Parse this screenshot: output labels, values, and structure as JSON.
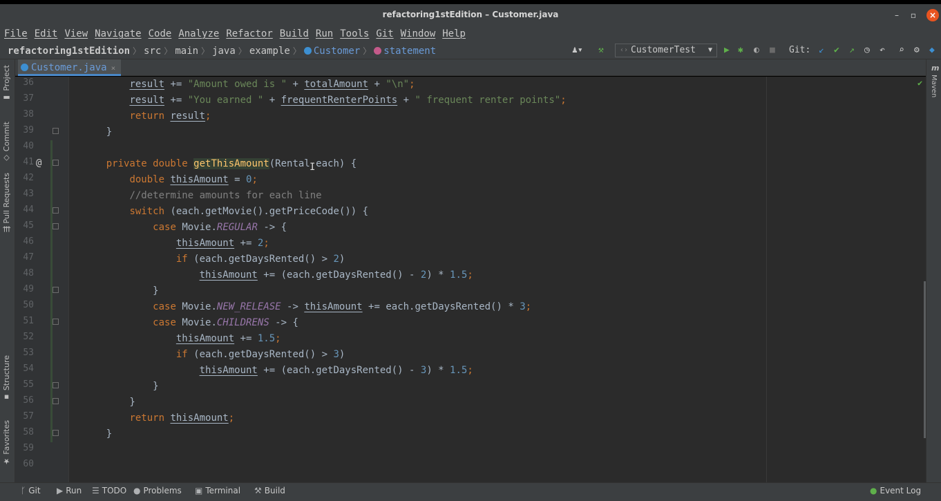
{
  "window": {
    "title": "refactoring1stEdition – Customer.java"
  },
  "menu": [
    "File",
    "Edit",
    "View",
    "Navigate",
    "Code",
    "Analyze",
    "Refactor",
    "Build",
    "Run",
    "Tools",
    "Git",
    "Window",
    "Help"
  ],
  "breadcrumb": {
    "project": "refactoring1stEdition",
    "parts": [
      "src",
      "main",
      "java",
      "example"
    ],
    "class": "Customer",
    "method": "statement"
  },
  "toolbar": {
    "run_config": "CustomerTest",
    "git_label": "Git:"
  },
  "editor_tab": {
    "label": "Customer.java",
    "close": "×"
  },
  "side_tabs": {
    "left": [
      "Project",
      "Commit",
      "Pull Requests",
      "Structure",
      "Favorites"
    ],
    "right": [
      "Maven"
    ]
  },
  "line_numbers": [
    "36",
    "37",
    "38",
    "39",
    "40",
    "41",
    "42",
    "43",
    "44",
    "45",
    "46",
    "47",
    "48",
    "49",
    "50",
    "51",
    "52",
    "53",
    "54",
    "55",
    "56",
    "57",
    "58",
    "59",
    "60"
  ],
  "statusbar": {
    "items": [
      "Git",
      "Run",
      "TODO",
      "Problems",
      "Terminal",
      "Build"
    ],
    "event_log": "Event Log"
  },
  "colors": {
    "keyword": "#cc7832",
    "string": "#6a8759",
    "number": "#6897bb",
    "comment": "#808080",
    "static_field": "#9876aa",
    "method_decl": "#ffc66d",
    "accent": "#4a88c7"
  }
}
